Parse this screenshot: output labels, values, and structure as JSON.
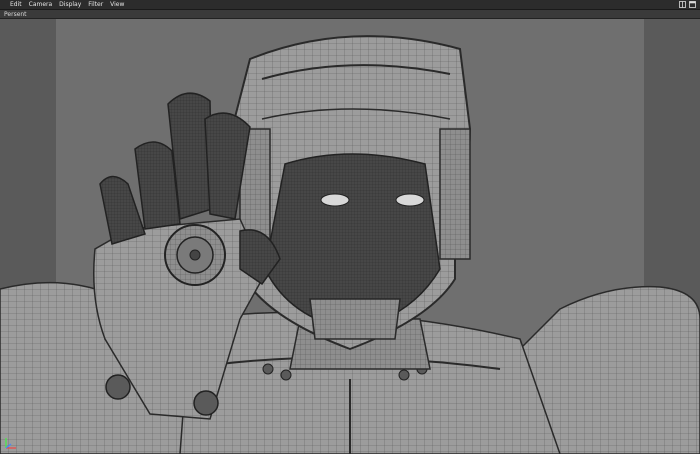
{
  "menu": {
    "items": [
      {
        "label": "Edit"
      },
      {
        "label": "Camera"
      },
      {
        "label": "Display"
      },
      {
        "label": "Filter"
      },
      {
        "label": "View"
      }
    ]
  },
  "viewport": {
    "panel_label": "Persent"
  },
  "icons": {
    "window_controls": [
      "layout-icon",
      "maximize-icon"
    ],
    "axis": "axis-gizmo-icon"
  },
  "colors": {
    "menubar": "#2c2c2c",
    "viewport_bg": "#6f6f6f",
    "gate_shade": "#5a5a5a",
    "wire": "#2a2a2a",
    "mesh_light": "#9a9a9a",
    "mesh_dark": "#3b3b3b"
  }
}
